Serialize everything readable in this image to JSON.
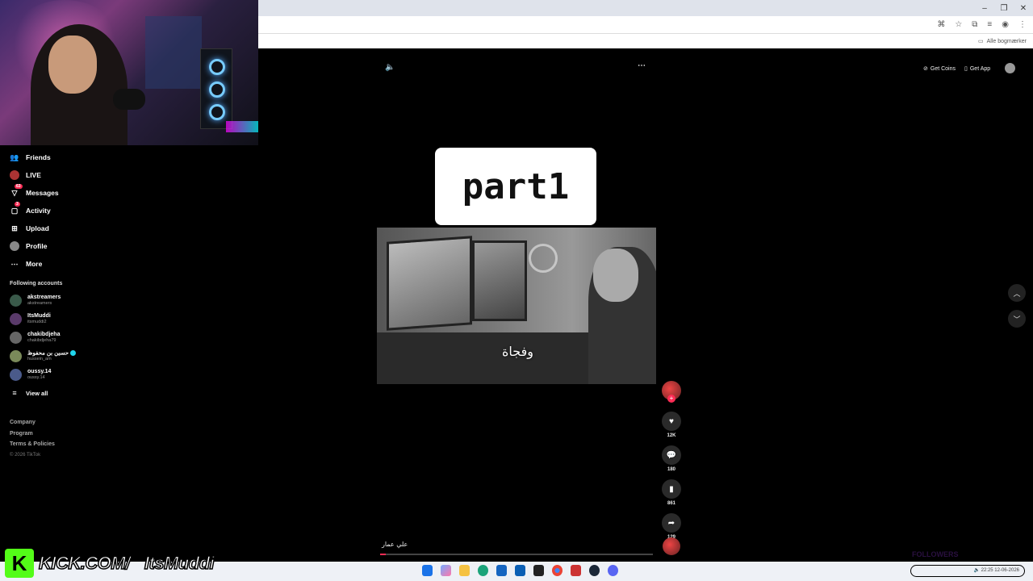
{
  "browser": {
    "bookmarks_label": "Alle bogmærker"
  },
  "sidebar": {
    "nav": [
      {
        "label": "Friends",
        "icon": "friends-icon"
      },
      {
        "label": "LIVE",
        "icon": "live-icon"
      },
      {
        "label": "Messages",
        "icon": "messages-icon",
        "badge": "63"
      },
      {
        "label": "Activity",
        "icon": "activity-icon",
        "badge": "3"
      },
      {
        "label": "Upload",
        "icon": "upload-icon"
      },
      {
        "label": "Profile",
        "icon": "profile-icon"
      },
      {
        "label": "More",
        "icon": "more-icon"
      }
    ],
    "following_title": "Following accounts",
    "following": [
      {
        "name": "akstreamers",
        "handle": "akstreamers"
      },
      {
        "name": "ItsMuddi",
        "handle": "itsmuddi2"
      },
      {
        "name": "chakibdjeha",
        "handle": "chakibdjeha79"
      },
      {
        "name": "حسين بن محفوظ",
        "handle": "hussein_am",
        "verified": true
      },
      {
        "name": "oussy.14",
        "handle": "oussy.14"
      }
    ],
    "view_all": "View all",
    "footer": [
      "Company",
      "Program",
      "Terms & Policies"
    ],
    "copyright": "© 2026 TikTok"
  },
  "header": {
    "get_coins": "Get Coins",
    "get_app": "Get App"
  },
  "video": {
    "title_card": "part1",
    "caption": "وفجاة",
    "author": "علي عمار",
    "progress": 0.02
  },
  "actions": {
    "likes": "12K",
    "comments": "180",
    "saves": "861",
    "shares": "129"
  },
  "overlay": {
    "kick_text": "KICK.COM/",
    "kick_user": "ItsMuddi",
    "followers_label": "FOLLOWERS"
  },
  "taskbar": {
    "time": "22:25",
    "date": "12-06-2026"
  },
  "colors": {
    "accent": "#fe2c55",
    "kick_green": "#53fc18",
    "verified": "#20d5ec"
  }
}
